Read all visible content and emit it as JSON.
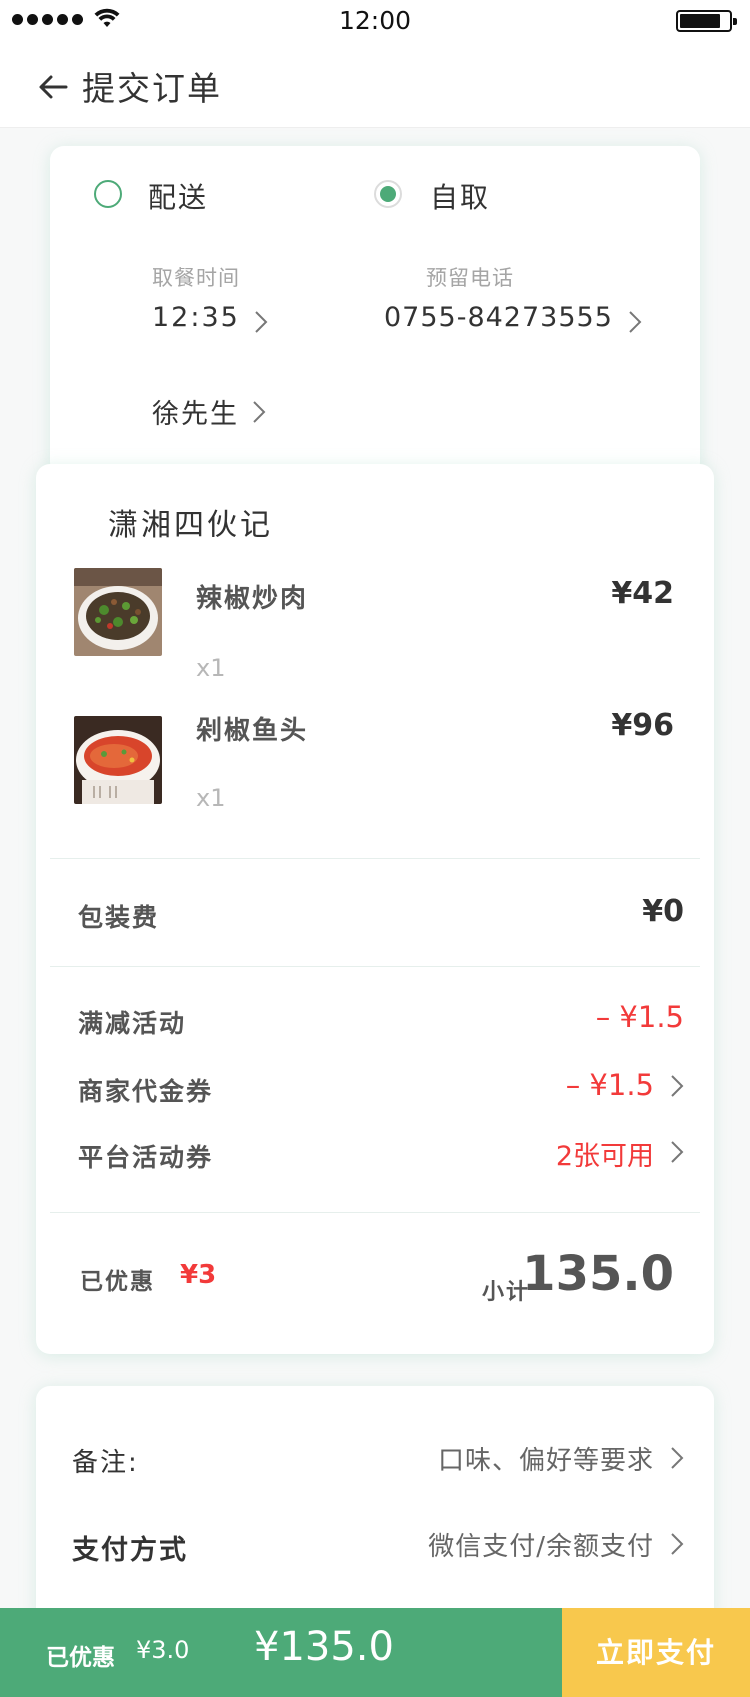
{
  "status_bar": {
    "time": "12:00"
  },
  "header": {
    "title": "提交订单"
  },
  "pickup": {
    "options": [
      {
        "label": "配送",
        "selected": false
      },
      {
        "label": "自取",
        "selected": true
      }
    ],
    "time_label": "取餐时间",
    "time_value": "12:35",
    "phone_label": "预留电话",
    "phone_value": "0755-84273555",
    "name_value": "徐先生"
  },
  "order": {
    "shop_name": "潇湘四伙记",
    "items": [
      {
        "name": "辣椒炒肉",
        "qty": "x1",
        "price": "¥42"
      },
      {
        "name": "剁椒鱼头",
        "qty": "x1",
        "price": "¥96"
      }
    ],
    "packing_label": "包装费",
    "packing_value": "¥0",
    "discount_label": "满减活动",
    "discount_value": "– ¥1.5",
    "voucher_label": "商家代金券",
    "voucher_value": "– ¥1.5",
    "platform_label": "平台活动券",
    "platform_value": "2张可用",
    "saved_label": "已优惠",
    "saved_value": "¥3",
    "subtotal_label": "小计",
    "subtotal_value": "135.0"
  },
  "extra": {
    "remark_label": "备注:",
    "remark_placeholder": "口味、偏好等要求",
    "pay_label": "支付方式",
    "pay_value": "微信支付/余额支付"
  },
  "bottom": {
    "saved_text": "已优惠",
    "saved_value": "¥3.0",
    "total": "¥135.0",
    "pay_button": "立即支付"
  },
  "colors": {
    "accent_green": "#4daa78",
    "pay_yellow": "#f8c84d",
    "discount_red": "#f23a3a"
  }
}
